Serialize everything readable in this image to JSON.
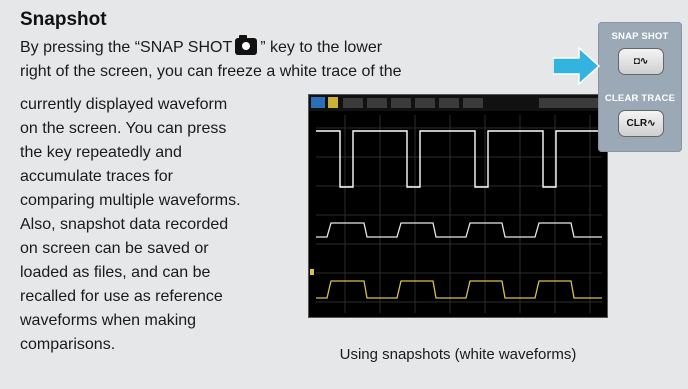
{
  "heading": "Snapshot",
  "intro": {
    "line1_before": "By pressing the “SNAP SHOT",
    "line1_after": "” key to the lower",
    "line2": "right of the screen, you can freeze a white trace of the"
  },
  "body_lines": [
    "currently displayed waveform",
    "on the screen. You can press",
    "the key repeatedly and",
    "accumulate traces for",
    "comparing multiple waveforms.",
    "Also, snapshot data recorded",
    "on screen can be saved or",
    "loaded as files, and can be",
    "recalled for use as reference",
    "waveforms when making",
    "comparisons."
  ],
  "caption": "Using snapshots (white waveforms)",
  "panel": {
    "snap_label": "SNAP SHOT",
    "snap_button_text": "◘∿",
    "clear_label": "CLEAR TRACE",
    "clear_button_text": "CLR∿"
  },
  "colors": {
    "background": "#e6e7e9",
    "arrow": "#33b3e0",
    "panel": "#9aa9b5",
    "trace_white": "#ffffff",
    "trace_yellow": "#d8c24a"
  },
  "icons": {
    "camera": "camera-icon",
    "arrow": "right-arrow-icon"
  }
}
